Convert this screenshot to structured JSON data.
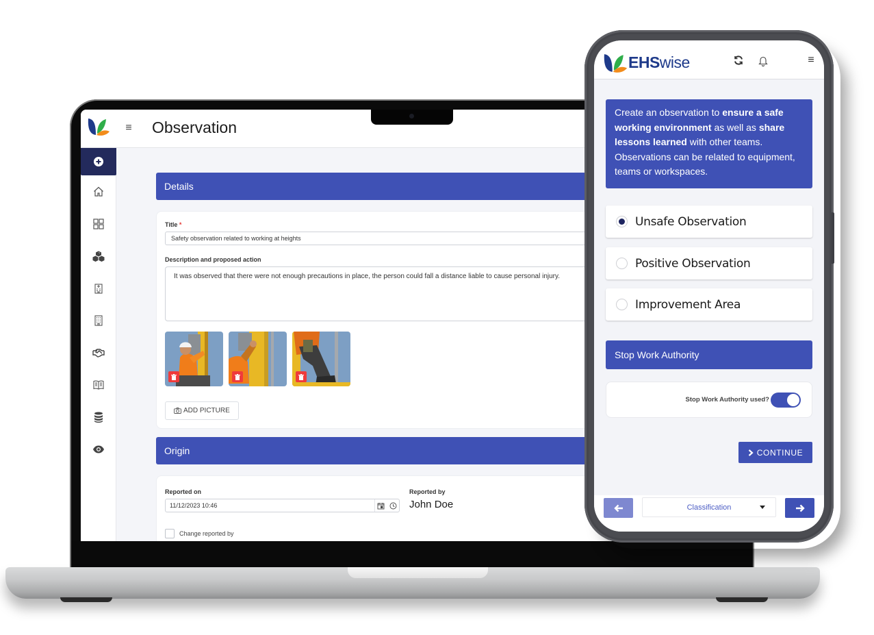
{
  "laptop": {
    "header": {
      "title": "Observation",
      "menu_icon": "hamburger-icon",
      "logo": "ehswise-logo-mark"
    },
    "sidebar": {
      "items": [
        {
          "name": "create",
          "icon": "plus-circle-icon",
          "active": true
        },
        {
          "name": "home",
          "icon": "home-icon",
          "active": false
        },
        {
          "name": "dashboard",
          "icon": "grid-icon",
          "active": false
        },
        {
          "name": "equipment",
          "icon": "cubes-icon",
          "active": false
        },
        {
          "name": "sites",
          "icon": "hospital-building-icon",
          "active": false
        },
        {
          "name": "buildings",
          "icon": "building-icon",
          "active": false
        },
        {
          "name": "partners",
          "icon": "handshake-icon",
          "active": false
        },
        {
          "name": "lessons",
          "icon": "book-open-icon",
          "active": false
        },
        {
          "name": "database",
          "icon": "database-icon",
          "active": false
        },
        {
          "name": "observations",
          "icon": "eye-icon",
          "active": false
        }
      ]
    },
    "details": {
      "section_title": "Details",
      "title_label": "Title",
      "title_required": "*",
      "title_value": "Safety observation related to working at heights",
      "description_label": "Description and proposed action",
      "description_value": "It was observed that there were not enough precautions in place, the person could fall a distance liable to cause personal injury.",
      "pictures": [
        {
          "alt": "worker-climbing-photo-1",
          "delete_icon": "trash-icon"
        },
        {
          "alt": "worker-climbing-photo-2",
          "delete_icon": "trash-icon"
        },
        {
          "alt": "worker-climbing-photo-3",
          "delete_icon": "trash-icon"
        }
      ],
      "add_picture_label": "ADD PICTURE"
    },
    "origin": {
      "section_title": "Origin",
      "reported_on_label": "Reported on",
      "reported_on_value": "11/12/2023 10:46",
      "reported_by_label": "Reported by",
      "reported_by_value": "John Doe",
      "change_reported_by_label": "Change reported by"
    }
  },
  "phone": {
    "brand": {
      "bold": "EHS",
      "regular": "wise"
    },
    "header_icons": [
      "refresh-icon",
      "bell-icon",
      "hamburger-icon"
    ],
    "intro": {
      "p1": "Create an observation to ",
      "b1": "ensure a safe working environment",
      "p2": " as well as ",
      "b2": "share lessons learned",
      "p3": " with other teams. Observations can be related to equipment, teams or workspaces."
    },
    "observation_types": [
      {
        "label": "Unsafe Observation",
        "selected": true
      },
      {
        "label": "Positive Observation",
        "selected": false
      },
      {
        "label": "Improvement Area",
        "selected": false
      }
    ],
    "stop_work": {
      "section_title": "Stop Work Authority",
      "question_label": "Stop Work Authority used?",
      "toggle_on": true
    },
    "continue_label": "CONTINUE",
    "footer": {
      "step_select_value": "Classification",
      "prev_icon": "arrow-left-icon",
      "next_icon": "arrow-right-icon"
    }
  },
  "colors": {
    "primary": "#3f51b5",
    "sidebar_active": "#232a5c",
    "danger": "#ef3b3b",
    "brand_blue": "#1e3a8a",
    "leaf_green": "#2fae4a",
    "leaf_orange": "#f28c1b"
  }
}
